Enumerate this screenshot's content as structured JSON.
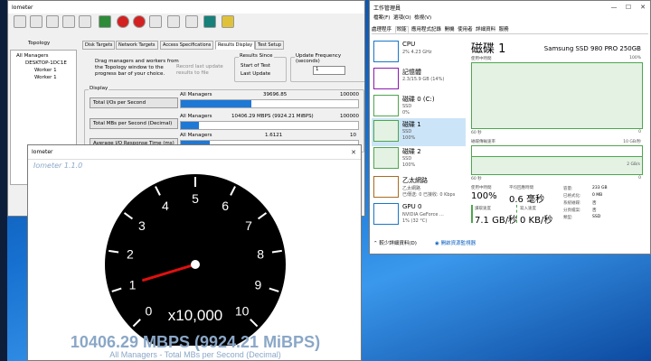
{
  "iometer_main": {
    "title": "Iometer",
    "tabs": [
      "Disk Targets",
      "Network Targets",
      "Access Specifications",
      "Results Display",
      "Test Setup"
    ],
    "topology_label": "Topology",
    "tree": [
      "All Managers",
      "DESKTOP-1DC1E",
      "Worker 1",
      "Worker 1"
    ],
    "drag_hint": "Drag managers and workers from the Topology window to the progress bar of your choice.",
    "record_label": "Record last update results to file",
    "results_since_label": "Results Since",
    "start_of_test": "Start of Test",
    "last_update": "Last Update",
    "update_freq_label": "Update Frequency (seconds)",
    "update_freq_value": "1",
    "display_label": "Display",
    "rows": [
      {
        "button": "Total I/Os per Second",
        "manager": "All Managers",
        "value": "39696.85",
        "max": "100000",
        "progress": 0.397
      },
      {
        "button": "Total MBs per Second (Decimal)",
        "manager": "All Managers",
        "value": "10406.29 MBPS (9924.21 MiBPS)",
        "max": "100000",
        "progress": 0.104
      },
      {
        "button": "Average I/O Response Time (ms)",
        "manager": "All Managers",
        "value": "1.6121",
        "max": "10",
        "progress": 0.161
      }
    ]
  },
  "gauge_window": {
    "title": "Iometer",
    "version": "Iometer 1.1.0",
    "ticks": [
      "0",
      "1",
      "2",
      "3",
      "4",
      "5",
      "6",
      "7",
      "8",
      "9",
      "10"
    ],
    "multiplier": "x10,000",
    "needle_value": 1.04,
    "readout": "10406.29 MBPS (9924.21 MiBPS)",
    "subtitle": "All Managers - Total MBs per Second (Decimal)"
  },
  "task_manager": {
    "title": "工作管理員",
    "menu": [
      "檔案(F)",
      "選項(O)",
      "檢視(V)"
    ],
    "tabs": [
      "處理程序",
      "效能",
      "應用程式記錄",
      "開機",
      "使用者",
      "詳細資料",
      "服務"
    ],
    "items": [
      {
        "name": "CPU",
        "sub1": "2% 4.23 GHz",
        "sub2": "",
        "color": "#1777c7"
      },
      {
        "name": "記憶體",
        "sub1": "2.3/15.9 GB (14%)",
        "sub2": "",
        "color": "#8b18b0"
      },
      {
        "name": "磁碟 0 (C:)",
        "sub1": "SSD",
        "sub2": "0%",
        "color": "#4da64d"
      },
      {
        "name": "磁碟 1",
        "sub1": "SSD",
        "sub2": "100%",
        "color": "#4da64d"
      },
      {
        "name": "磁碟 2",
        "sub1": "SSD",
        "sub2": "100%",
        "color": "#4da64d"
      },
      {
        "name": "乙太網路",
        "sub1": "乙太網路",
        "sub2": "已傳送: 0 已接收: 0 Kbps",
        "color": "#a76b21"
      },
      {
        "name": "GPU 0",
        "sub1": "NVIDIA GeForce ...",
        "sub2": "1% (32 °C)",
        "color": "#1777c7"
      }
    ],
    "disk_title": "磁碟 1",
    "disk_model": "Samsung SSD 980 PRO 250GB",
    "active_time_label": "使用中時間",
    "active_max": "100%",
    "sixty_sec": "60 秒",
    "zero": "0",
    "transfer_label": "磁碟傳輸速率",
    "transfer_max": "10 GB/秒",
    "graph_mark": "2 GB/s",
    "stats": {
      "active_label": "使用中時間",
      "active_value": "100%",
      "resp_label": "平均回應時間",
      "resp_value": "0.6 毫秒",
      "read_label": "讀取速度",
      "read_value": "7.1 GB/秒",
      "write_label": "寫入速度",
      "write_value": "0 KB/秒",
      "capacity_label": "容量:",
      "capacity_value": "233 GB",
      "formatted_label": "已格式化:",
      "formatted_value": "0 MB",
      "sysdisk_label": "系統磁碟:",
      "sysdisk_value": "否",
      "pagefile_label": "分頁檔案:",
      "pagefile_value": "否",
      "type_label": "類型:",
      "type_value": "SSD"
    },
    "fewer_details": "較少詳細資料(D)",
    "resource_monitor": "開啟資源監視器"
  }
}
